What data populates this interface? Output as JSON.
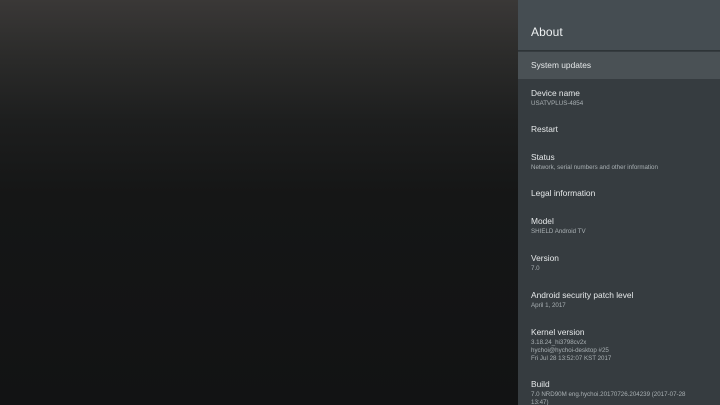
{
  "panel": {
    "title": "About"
  },
  "items": [
    {
      "id": "system-updates",
      "title": "System updates",
      "subtitle": "",
      "focused": true
    },
    {
      "id": "device-name",
      "title": "Device name",
      "subtitle": "USATVPLUS-4854"
    },
    {
      "id": "restart",
      "title": "Restart",
      "subtitle": ""
    },
    {
      "id": "status",
      "title": "Status",
      "subtitle": "Network, serial numbers and other information"
    },
    {
      "id": "legal-information",
      "title": "Legal information",
      "subtitle": ""
    },
    {
      "id": "model",
      "title": "Model",
      "subtitle": "SHIELD Android TV"
    },
    {
      "id": "version",
      "title": "Version",
      "subtitle": "7.0"
    },
    {
      "id": "security-patch",
      "title": "Android security patch level",
      "subtitle": "April 1, 2017"
    },
    {
      "id": "kernel-version",
      "title": "Kernel version",
      "subtitle": "3.18.24_hi3798cv2x\nhychoi@hychoi-desktop #25\nFri Jul 28 13:52:07 KST 2017"
    },
    {
      "id": "build",
      "title": "Build",
      "subtitle": "7.0 NRD90M eng.hychoi.20170726.204239 (2017-07-28\n13:47)"
    }
  ]
}
